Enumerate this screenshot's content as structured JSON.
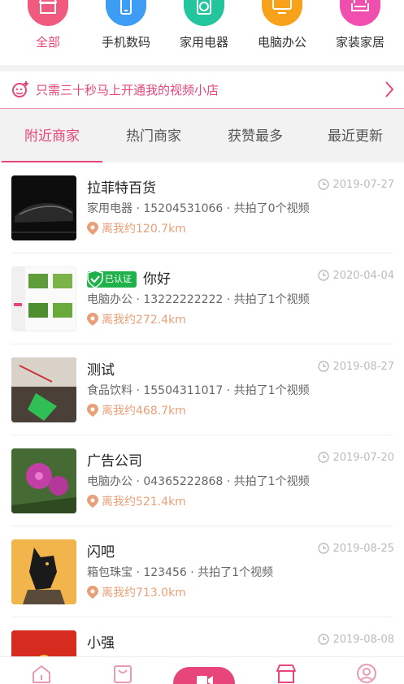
{
  "categories": [
    {
      "label": "全部",
      "icon": "store-icon",
      "color": "#f05a7e",
      "active": true
    },
    {
      "label": "手机数码",
      "icon": "phone-icon",
      "color": "#3d9df5",
      "active": false
    },
    {
      "label": "家用电器",
      "icon": "washer-icon",
      "color": "#22c59c",
      "active": false
    },
    {
      "label": "电脑办公",
      "icon": "monitor-icon",
      "color": "#f8a21c",
      "active": false
    },
    {
      "label": "家装家居",
      "icon": "sofa-icon",
      "color": "#f04fb0",
      "active": false
    }
  ],
  "banner": {
    "text": "只需三十秒马上开通我的视频小店",
    "icon": "sparkle-smile-icon",
    "arrow": "chevron-right-icon"
  },
  "tabs": [
    {
      "label": "附近商家",
      "active": true
    },
    {
      "label": "热门商家",
      "active": false
    },
    {
      "label": "获赞最多",
      "active": false
    },
    {
      "label": "最近更新",
      "active": false
    }
  ],
  "shops": [
    {
      "name": "拉菲特百货",
      "verified": false,
      "meta": "家用电器 · 15204531066 · 共拍了0个视频",
      "distance": "离我约120.7km",
      "date": "2019-07-27"
    },
    {
      "name": "你好",
      "verified": true,
      "verified_label": "已认证",
      "meta": "电脑办公 · 13222222222 · 共拍了1个视频",
      "distance": "离我约272.4km",
      "date": "2020-04-04"
    },
    {
      "name": "测试",
      "verified": false,
      "meta": "食品饮料 · 15504311017 · 共拍了1个视频",
      "distance": "离我约468.7km",
      "date": "2019-08-27"
    },
    {
      "name": "广告公司",
      "verified": false,
      "meta": "电脑办公 · 04365222868 · 共拍了1个视频",
      "distance": "离我约521.4km",
      "date": "2019-07-20"
    },
    {
      "name": "闪吧",
      "verified": false,
      "meta": "箱包珠宝 · 123456 · 共拍了1个视频",
      "distance": "离我约713.0km",
      "date": "2019-08-25"
    },
    {
      "name": "小强",
      "verified": false,
      "meta": "",
      "distance": "",
      "date": "2019-08-08"
    }
  ],
  "colors": {
    "accent": "#e8467a",
    "distance": "#e8a078",
    "verified": "#1fb24a"
  },
  "bottom_nav": [
    {
      "icon": "home-icon"
    },
    {
      "icon": "bag-icon"
    },
    {
      "icon": "video-camera-icon"
    },
    {
      "icon": "shop-icon"
    },
    {
      "icon": "user-icon"
    }
  ]
}
